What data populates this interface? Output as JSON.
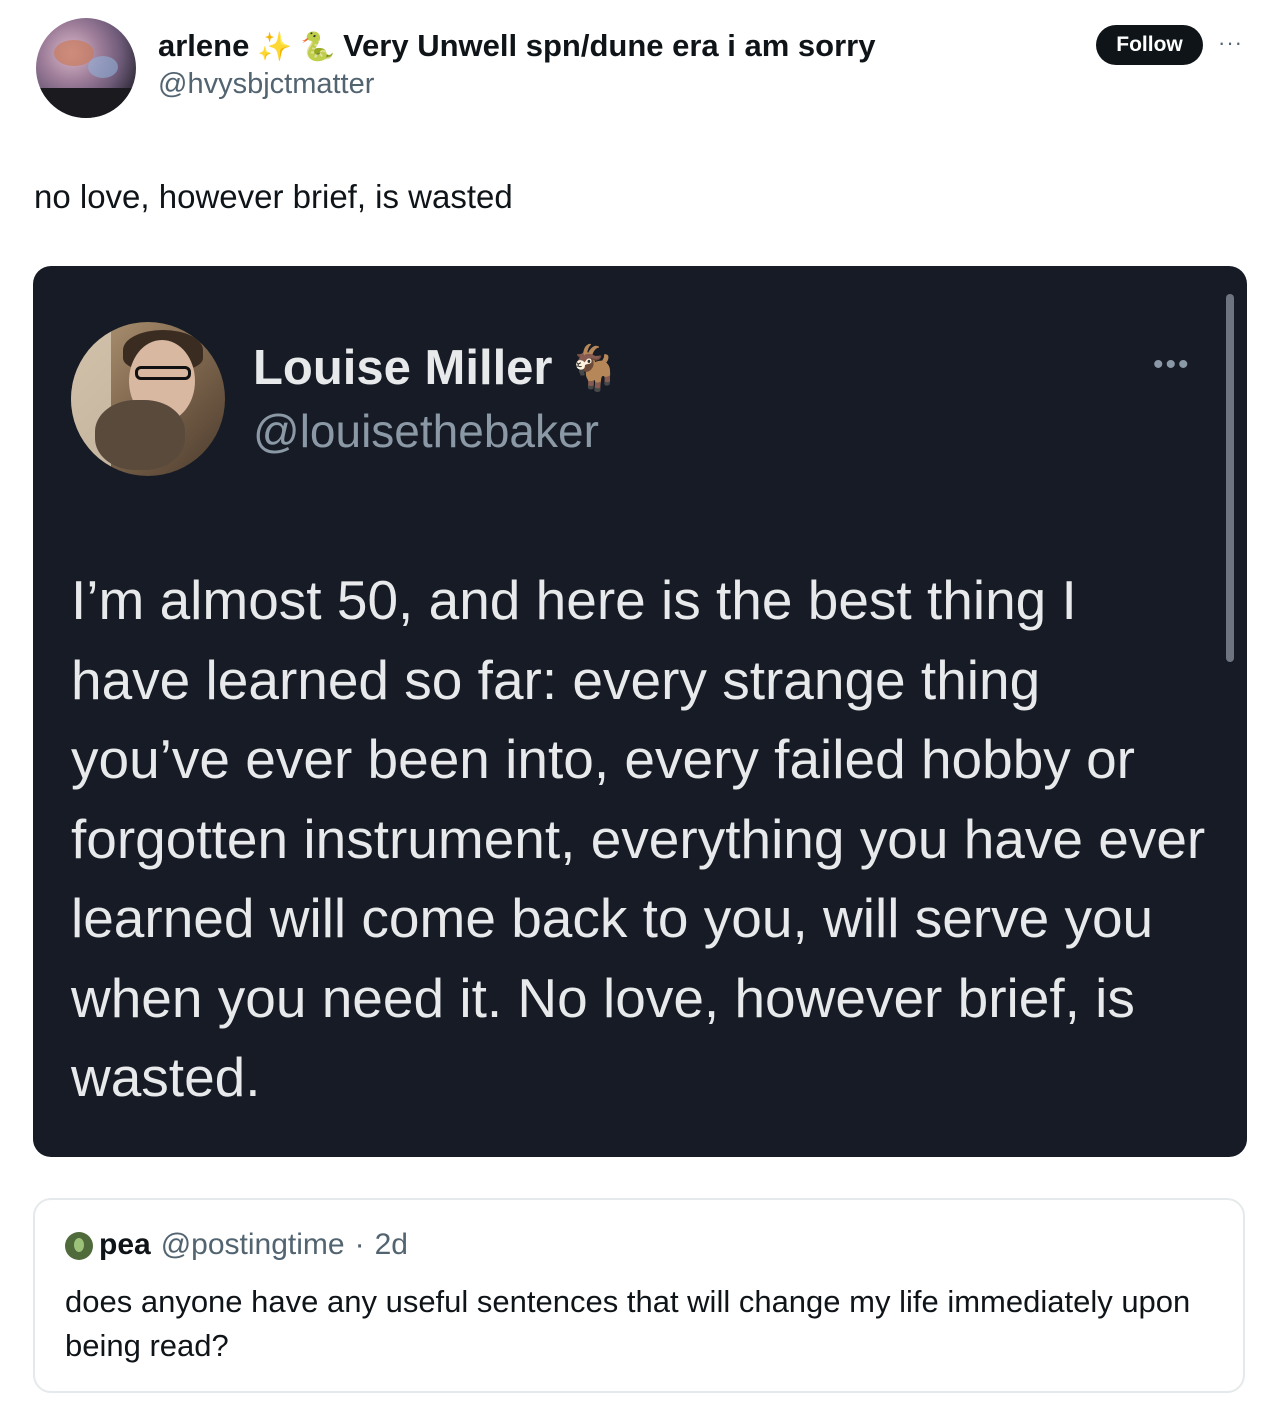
{
  "post": {
    "display_name": "arlene",
    "emoji_1": "✨",
    "emoji_2": "🐍",
    "display_name_suffix": "Very Unwell spn/dune era i am sorry",
    "handle": "@hvysbjctmatter",
    "follow_label": "Follow",
    "more_label": "···",
    "text": "no love, however brief, is wasted"
  },
  "quoted_image": {
    "name": "Louise Miller",
    "emoji": "🐐",
    "handle": "@louisethebaker",
    "more_label": "•••",
    "body": "I’m almost 50, and here is the best thing I have learned so far: every strange thing you’ve ever been into, every failed hobby or forgotten instrument, everything you have ever learned will come back to you, will serve you when you need it. No love, however brief, is wasted."
  },
  "reply": {
    "name": "pea",
    "handle": "@postingtime",
    "separator": "·",
    "time": "2d",
    "text": "does anyone have any useful sentences that will change my life immediately upon being read?"
  }
}
